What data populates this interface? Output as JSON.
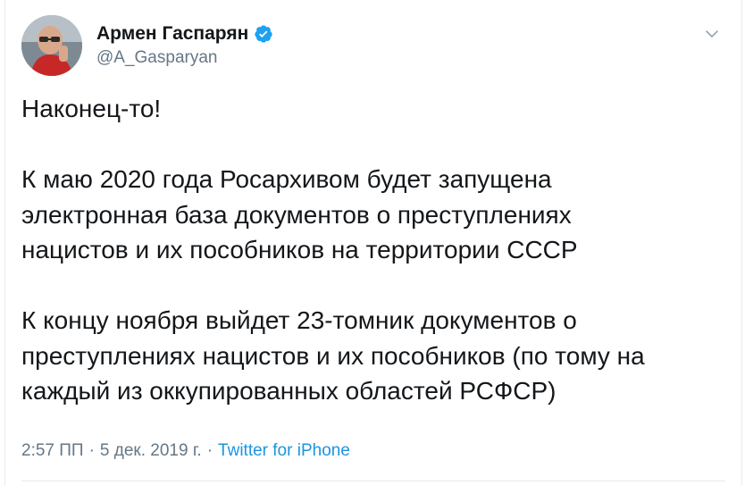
{
  "author": {
    "display_name": "Армен Гаспарян",
    "handle": "@A_Gasparyan",
    "verified": true
  },
  "tweet": {
    "paragraphs": [
      [
        "Наконец-то!"
      ],
      [
        "К маю 2020 года Росархивом будет запущена",
        "электронная база документов о преступлениях",
        "нацистов и их пособников на территории СССР"
      ],
      [
        "К концу ноября выйдет 23-томник документов о",
        "преступлениях нацистов и их пособников (по тому на",
        "каждый из оккупированных областей РСФСР)"
      ]
    ]
  },
  "meta": {
    "time": "2:57 ПП",
    "separator": "·",
    "date": "5 дек. 2019 г.",
    "source": "Twitter for iPhone"
  },
  "icons": {
    "verified": "verified-badge-icon",
    "caret": "chevron-down-icon"
  },
  "colors": {
    "text": "#14171a",
    "secondary": "#657786",
    "link": "#1b95e0",
    "verified": "#1da1f2"
  }
}
